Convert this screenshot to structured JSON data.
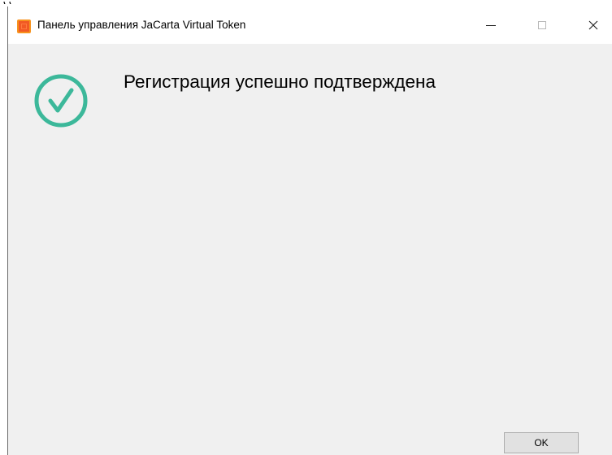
{
  "window": {
    "title": "Панель управления JaCarta Virtual Token"
  },
  "titlebar_buttons": {
    "minimize": "minimize-icon",
    "maximize": "maximize-icon",
    "close": "close-icon"
  },
  "content": {
    "status_icon": "check-circle-icon",
    "message": "Регистрация успешно подтверждена"
  },
  "footer": {
    "ok_label": "OK"
  },
  "colors": {
    "accent_check": "#3cb89a",
    "app_icon": "#f15a24",
    "dialog_background": "#f0f0f0"
  }
}
